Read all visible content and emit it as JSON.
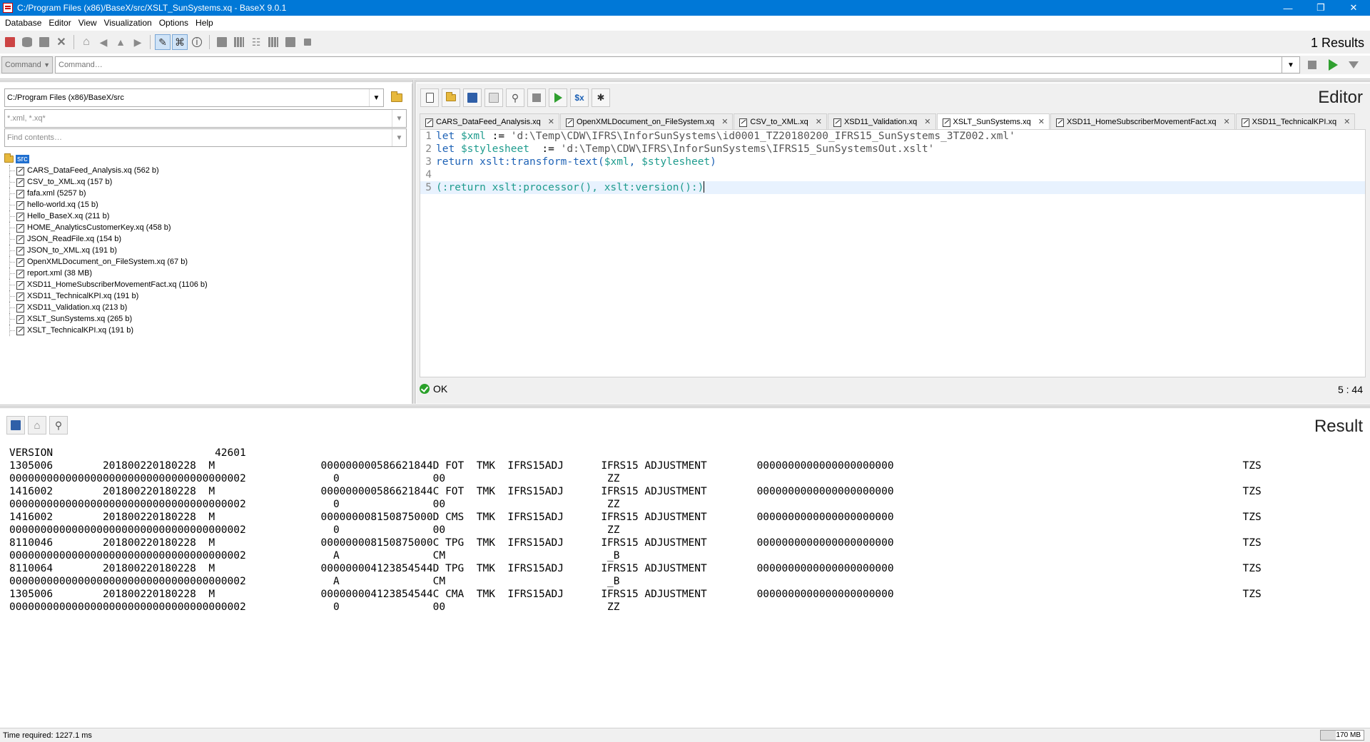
{
  "window": {
    "title": "C:/Program Files (x86)/BaseX/src/XSLT_SunSystems.xq - BaseX 9.0.1",
    "minimize": "—",
    "maximize": "❐",
    "close": "✕"
  },
  "menubar": [
    "Database",
    "Editor",
    "View",
    "Visualization",
    "Options",
    "Help"
  ],
  "toolbar": {
    "results_count": "1 Results"
  },
  "command": {
    "mode": "Command",
    "placeholder": "Command…"
  },
  "project": {
    "path": "C:/Program Files (x86)/BaseX/src",
    "filter_placeholder": "*.xml, *.xq*",
    "find_placeholder": "Find contents…",
    "root": "src",
    "files": [
      "CARS_DataFeed_Analysis.xq (562 b)",
      "CSV_to_XML.xq (157 b)",
      "fafa.xml (5257 b)",
      "hello-world.xq (15 b)",
      "Hello_BaseX.xq (211 b)",
      "HOME_AnalyticsCustomerKey.xq (458 b)",
      "JSON_ReadFile.xq (154 b)",
      "JSON_to_XML.xq (191 b)",
      "OpenXMLDocument_on_FileSystem.xq (67 b)",
      "report.xml (38 MB)",
      "XSD11_HomeSubscriberMovementFact.xq (1106 b)",
      "XSD11_TechnicalKPI.xq (191 b)",
      "XSD11_Validation.xq (213 b)",
      "XSLT_SunSystems.xq (265 b)",
      "XSLT_TechnicalKPI.xq (191 b)"
    ]
  },
  "editor": {
    "title": "Editor",
    "tabs": [
      "CARS_DataFeed_Analysis.xq",
      "OpenXMLDocument_on_FileSystem.xq",
      "CSV_to_XML.xq",
      "XSD11_Validation.xq",
      "XSLT_SunSystems.xq",
      "XSD11_HomeSubscriberMovementFact.xq",
      "XSD11_TechnicalKPI.xq"
    ],
    "active_tab": "XSLT_SunSystems.xq",
    "code": {
      "l1_kw": "let",
      "l1_var": "$xml",
      "l1_op": " := ",
      "l1_str": "'d:\\Temp\\CDW\\IFRS\\InforSunSystems\\id0001_TZ20180200_IFRS15_SunSystems_3TZ002.xml'",
      "l2_kw": "let",
      "l2_var": "$stylesheet",
      "l2_op": "  := ",
      "l2_str": "'d:\\Temp\\CDW\\IFRS\\InforSunSystems\\IFRS15_SunSystemsOut.xslt'",
      "l3_kw": "return",
      "l3_fn": "xslt:transform-text(",
      "l3_v1": "$xml",
      "l3_sep": ", ",
      "l3_v2": "$stylesheet",
      "l3_end": ")",
      "l5": "(:return xslt:processor(), xslt:version():)"
    },
    "status": "OK",
    "cursor": "5 : 44"
  },
  "result": {
    "title": "Result",
    "text": "VERSION                          42601\n1305006        201800220180228  M                 000000000586621844D FOT  TMK  IFRS15ADJ      IFRS15 ADJUSTMENT        0000000000000000000000                                                        TZS\n00000000000000000000000000000000000002              0               00                          ZZ\n1416002        201800220180228  M                 000000000586621844C FOT  TMK  IFRS15ADJ      IFRS15 ADJUSTMENT        0000000000000000000000                                                        TZS\n00000000000000000000000000000000000002              0               00                          ZZ\n1416002        201800220180228  M                 000000008150875000D CMS  TMK  IFRS15ADJ      IFRS15 ADJUSTMENT        0000000000000000000000                                                        TZS\n00000000000000000000000000000000000002              0               00                          ZZ\n8110046        201800220180228  M                 000000008150875000C TPG  TMK  IFRS15ADJ      IFRS15 ADJUSTMENT        0000000000000000000000                                                        TZS\n00000000000000000000000000000000000002              A               CM                          _B\n8110064        201800220180228  M                 000000004123854544D TPG  TMK  IFRS15ADJ      IFRS15 ADJUSTMENT        0000000000000000000000                                                        TZS\n00000000000000000000000000000000000002              A               CM                          _B\n1305006        201800220180228  M                 000000004123854544C CMA  TMK  IFRS15ADJ      IFRS15 ADJUSTMENT        0000000000000000000000                                                        TZS\n00000000000000000000000000000000000002              0               00                          ZZ"
  },
  "statusbar": {
    "time_required": "Time required: 1227.1 ms",
    "memory": "170 MB",
    "memory_fill": 0.35
  }
}
